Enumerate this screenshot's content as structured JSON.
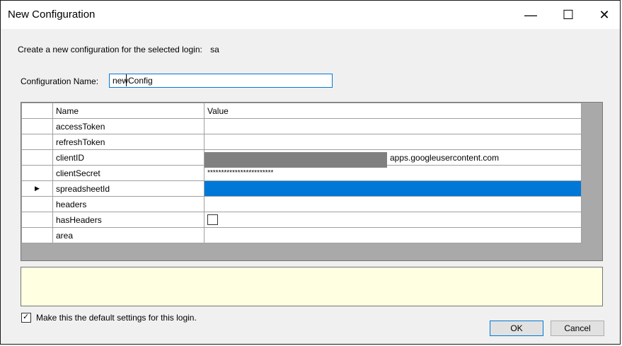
{
  "window": {
    "title": "New Configuration",
    "min": "—",
    "max": "☐",
    "close": "✕"
  },
  "prompt": {
    "text": "Create a new configuration for the selected login:",
    "login": "sa"
  },
  "config": {
    "label": "Configuration Name:",
    "value": "newConfig"
  },
  "grid": {
    "headers": [
      "Name",
      "Value"
    ],
    "rows": [
      {
        "name": "accessToken",
        "value": ""
      },
      {
        "name": "refreshToken",
        "value": ""
      },
      {
        "name": "clientID",
        "value": "apps.googleusercontent.com"
      },
      {
        "name": "clientSecret",
        "value": "************************"
      },
      {
        "name": "spreadsheetId",
        "value": ""
      },
      {
        "name": "headers",
        "value": ""
      },
      {
        "name": "hasHeaders",
        "value": ""
      },
      {
        "name": "area",
        "value": ""
      }
    ],
    "current_row_marker": "▶"
  },
  "default_checkbox": {
    "label": "Make this the default settings for this login.",
    "checked": true,
    "mark": "✓"
  },
  "buttons": {
    "ok": "OK",
    "cancel": "Cancel"
  }
}
